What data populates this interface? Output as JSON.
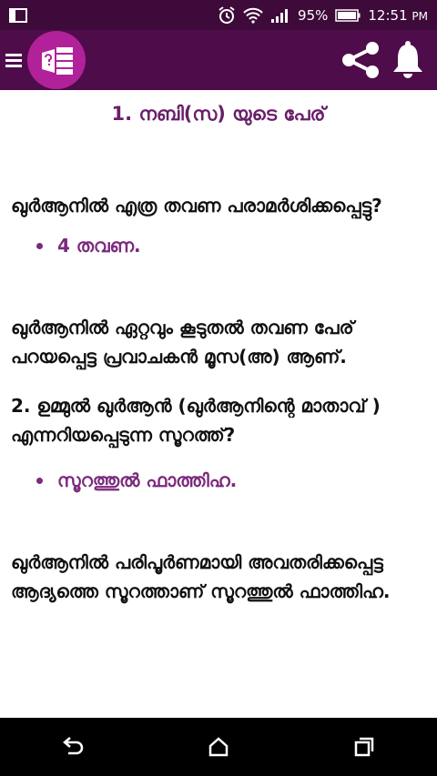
{
  "status": {
    "battery": "95%",
    "time": "12:51",
    "ampm": "PM"
  },
  "toolbar": {
    "menu_icon": "hamburger-icon",
    "logo_icon": "quiz-logo-icon",
    "share_icon": "share-icon",
    "bell_icon": "bell-icon"
  },
  "content": {
    "q1_title": "1.  നബി(സ) യുടെ പേര്",
    "q1_question": "ഖുർആനിൽ എത്ര തവണ പരാമർശിക്കപ്പെട്ടു?",
    "q1_answer": "4 തവണ.",
    "q1_explanation": "ഖുർആനിൽ ഏറ്റവും കൂടുതൽ തവണ പേര് പറയപ്പെട്ട പ്രവാചകൻ മൂസ(അ) ആണ്.",
    "q2_question": "2.  ഉമ്മുൽ ഖുർആൻ (ഖുർആനിന്റെ മാതാവ് ) എന്നറിയപ്പെടുന്ന സൂറത്ത്?",
    "q2_answer": "സൂറത്തുൽ ഫാത്തിഹ.",
    "q2_explanation": "ഖുർആനിൽ പരിപൂർണമായി അവതരിക്കപ്പെട്ട ആദ്യത്തെ സൂറത്താണ് സൂറത്തുൽ ഫാത്തിഹ."
  },
  "colors": {
    "statusbar": "#3d0a3a",
    "toolbar": "#4e0c4a",
    "logo": "#b0219a",
    "title_text": "#6a1e6a",
    "answer_text": "#7b2a7d"
  }
}
